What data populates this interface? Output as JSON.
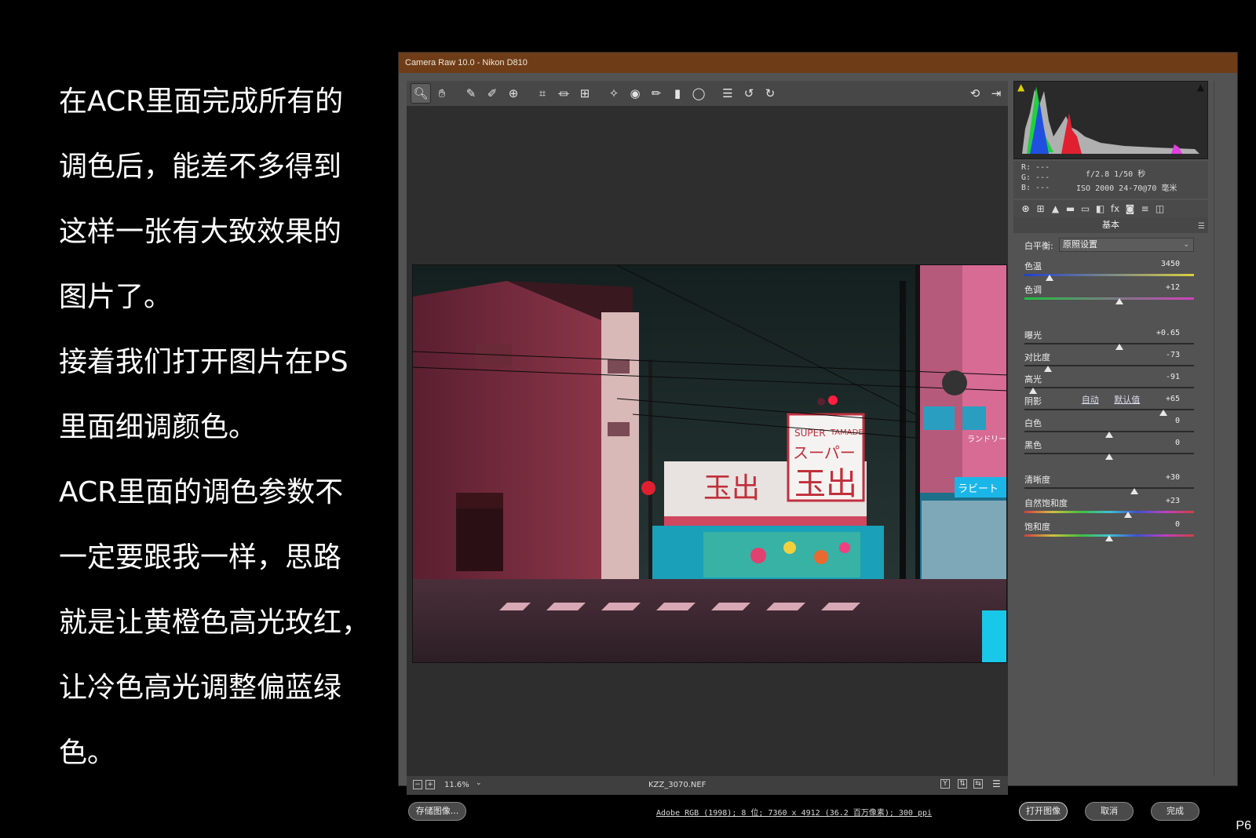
{
  "narration": [
    "在ACR里面完成所有的",
    "调色后，能差不多得到",
    "这样一张有大致效果的",
    "图片了。",
    "接着我们打开图片在PS",
    "里面细调颜色。",
    "ACR里面的调色参数不",
    "一定要跟我一样，思路",
    "就是让黄橙色高光玫红，",
    "让冷色高光调整偏蓝绿",
    "色。"
  ],
  "page_number": "P6",
  "window": {
    "title": "Camera Raw 10.0 -  Nikon D810"
  },
  "toolbar": {
    "tools": [
      {
        "icon": "zoom-icon",
        "glyph": "🔍︎"
      },
      {
        "icon": "hand-icon",
        "glyph": "✋︎"
      },
      {
        "icon": "white-balance-icon",
        "glyph": "✎"
      },
      {
        "icon": "color-sampler-icon",
        "glyph": "✐"
      },
      {
        "icon": "targeted-adjust-icon",
        "glyph": "⊕"
      },
      {
        "icon": "crop-icon",
        "glyph": "⌗"
      },
      {
        "icon": "straighten-icon",
        "glyph": "⏛"
      },
      {
        "icon": "transform-icon",
        "glyph": "⊞"
      },
      {
        "icon": "spot-removal-icon",
        "glyph": "✧"
      },
      {
        "icon": "red-eye-icon",
        "glyph": "◉"
      },
      {
        "icon": "adjustment-brush-icon",
        "glyph": "✏"
      },
      {
        "icon": "graduated-filter-icon",
        "glyph": "▮"
      },
      {
        "icon": "radial-filter-icon",
        "glyph": "◯"
      },
      {
        "icon": "preferences-icon",
        "glyph": "☰"
      },
      {
        "icon": "rotate-left-icon",
        "glyph": "↺"
      },
      {
        "icon": "rotate-right-icon",
        "glyph": "↻"
      }
    ],
    "right_tools": [
      {
        "icon": "toggle-fullscreen-icon",
        "glyph": "⟲"
      },
      {
        "icon": "export-icon",
        "glyph": "⇥"
      }
    ]
  },
  "zoombar": {
    "zoom": "11.6%",
    "filename": "KZZ_3070.NEF",
    "view_label": "Y"
  },
  "exif": {
    "rgb": [
      "R: ---",
      "G: ---",
      "B: ---"
    ],
    "aperture_shutter": "f/2.8   1/50 秒",
    "iso_lens": "ISO 2000   24-70@70 毫米"
  },
  "panel": {
    "title": "基本",
    "tabs": [
      "⊛",
      "⊞",
      "▲",
      "▬",
      "▭",
      "◧",
      "fx",
      "◙",
      "≡",
      "◫"
    ],
    "wb_label": "白平衡:",
    "wb_value": "原照设置",
    "auto": "自动",
    "default": "默认值",
    "sliders": [
      {
        "label": "色温",
        "value": "3450",
        "pos": 0.15,
        "track": "temp"
      },
      {
        "label": "色调",
        "value": "+12",
        "pos": 0.56,
        "track": "tint"
      },
      {
        "label": "曝光",
        "value": "+0.65",
        "pos": 0.56,
        "track": "plain"
      },
      {
        "label": "对比度",
        "value": "-73",
        "pos": 0.14,
        "track": "plain"
      },
      {
        "label": "高光",
        "value": "-91",
        "pos": 0.05,
        "track": "plain"
      },
      {
        "label": "阴影",
        "value": "+65",
        "pos": 0.82,
        "track": "plain"
      },
      {
        "label": "白色",
        "value": "0",
        "pos": 0.5,
        "track": "plain"
      },
      {
        "label": "黑色",
        "value": "0",
        "pos": 0.5,
        "track": "plain"
      },
      {
        "label": "清晰度",
        "value": "+30",
        "pos": 0.65,
        "track": "plain"
      },
      {
        "label": "自然饱和度",
        "value": "+23",
        "pos": 0.61,
        "track": "rainbow"
      },
      {
        "label": "饱和度",
        "value": "0",
        "pos": 0.5,
        "track": "rainbow"
      }
    ]
  },
  "bottom": {
    "save": "存储图像...",
    "file_info": "Adobe RGB (1998); 8 位; 7360 x 4912 (36.2 百万像素); 300 ppi",
    "open": "打开图像",
    "cancel": "取消",
    "done": "完成"
  },
  "photo": {
    "sign_left": "玉出",
    "sign_super": "SUPER",
    "sign_tamade": "TAMADE",
    "sign_katakana": "スーパー",
    "sign_big": "玉出",
    "sign_blue": "ラビート",
    "sign_laundry": "ランドリー"
  }
}
